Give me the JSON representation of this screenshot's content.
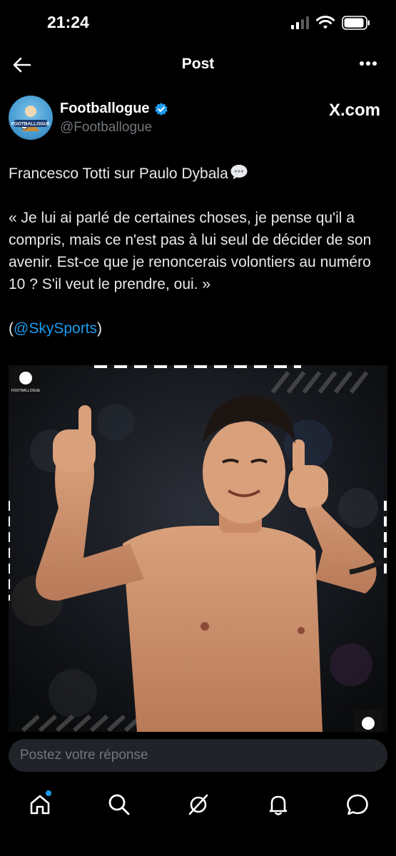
{
  "status": {
    "time": "21:24"
  },
  "header": {
    "title": "Post"
  },
  "author": {
    "name": "Footballogue",
    "handle": "@Footballogue",
    "avatar_text": "FOOTBALLOGUE",
    "source": "X.com"
  },
  "post": {
    "line1": "Francesco Totti sur Paulo Dybala",
    "quote": "« Je lui ai parlé de certaines choses, je pense qu'il a compris, mais ce n'est pas à lui seul de décider de son avenir. Est-ce que je renoncerais volontiers au numéro 10 ? S'il veut le prendre, oui. »",
    "credit_open": "(",
    "credit_mention": "@SkySports",
    "credit_close": ")"
  },
  "media": {
    "watermark_text": "FOOTBALLOGUE"
  },
  "reply": {
    "placeholder": "Postez votre réponse"
  },
  "nav": {
    "items": [
      {
        "icon": "home-icon",
        "notification_dot": true
      },
      {
        "icon": "search-icon"
      },
      {
        "icon": "grok-icon"
      },
      {
        "icon": "bell-icon"
      },
      {
        "icon": "messages-icon"
      }
    ]
  },
  "colors": {
    "accent": "#1d9bf0",
    "background": "#000000",
    "muted": "#71767b"
  }
}
